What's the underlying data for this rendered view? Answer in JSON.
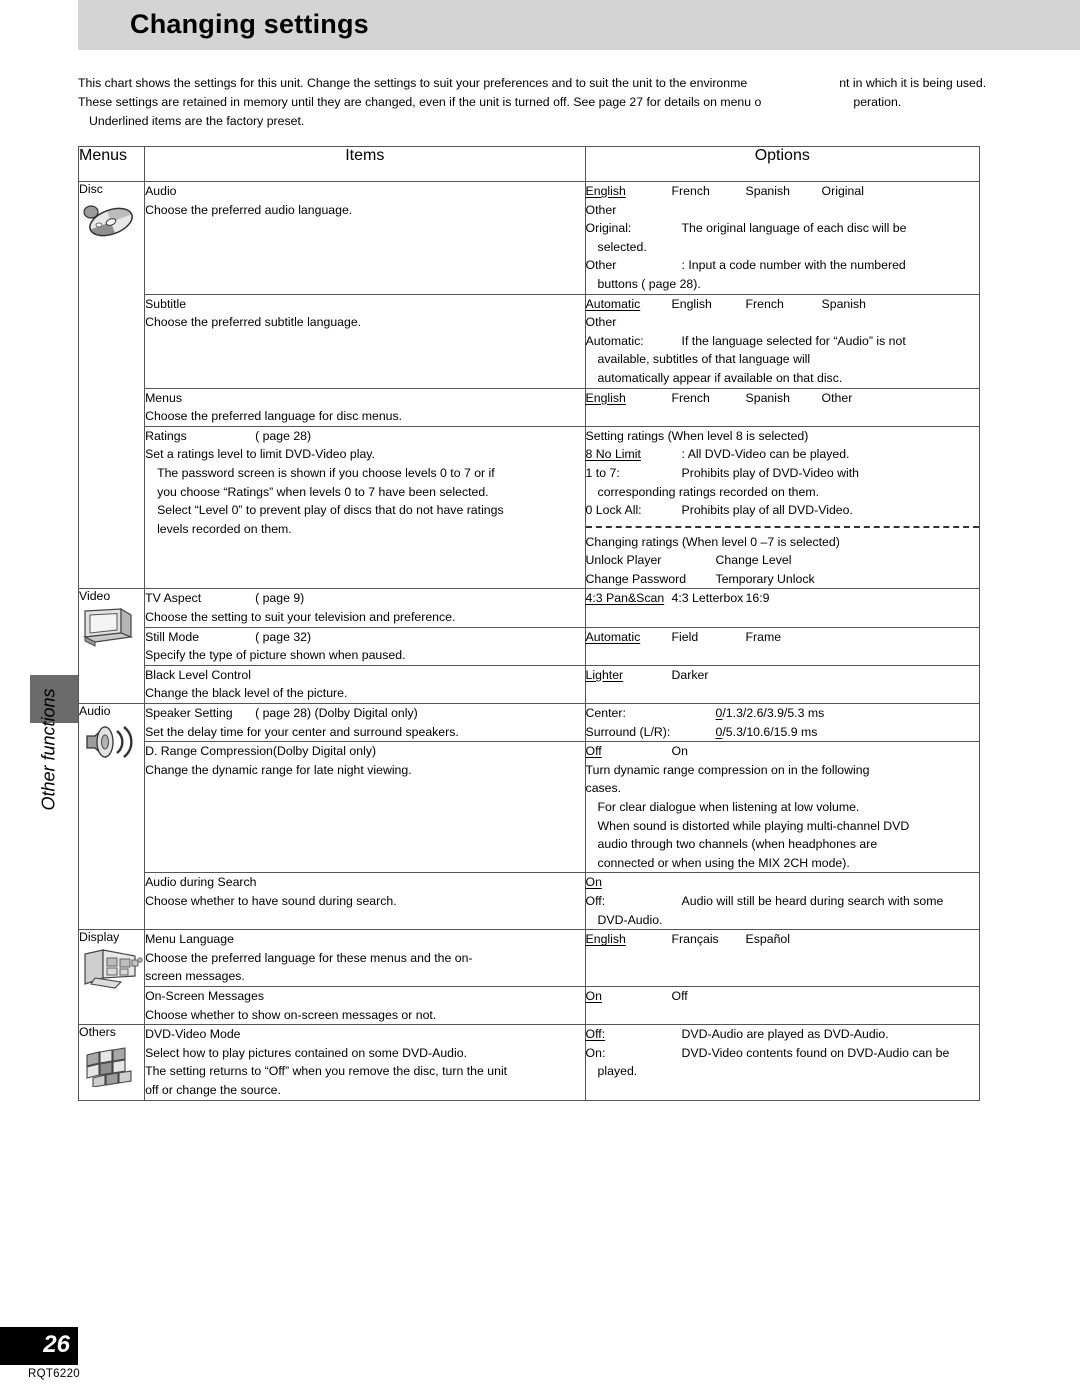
{
  "header": {
    "title": "Changing settings"
  },
  "intro": {
    "line1a": "This chart shows the settings for this unit. Change the settings to suit your preferences and to suit the unit to the environme",
    "line1b": "nt in which it is being used.",
    "line2a": "These settings are retained in memory until they are changed, even if the unit is turned off. See page 27 for details on menu o",
    "line2b": "peration.",
    "line3": "Underlined items are the factory preset."
  },
  "side_tab": {
    "label": "Other functions"
  },
  "footer": {
    "page_number": "26",
    "model_code": "RQT6220"
  },
  "table": {
    "headers": {
      "menus": "Menus",
      "items": "Items",
      "options": "Options"
    },
    "sections": [
      {
        "menu_label": "Disc",
        "menu_icon": "disc-icon",
        "rows": [
          {
            "title": "Audio",
            "desc": "Choose the preferred audio language.",
            "options": {
              "choices": [
                "English",
                "French",
                "Spanish",
                "Original",
                "Other"
              ],
              "preset": "English",
              "notes": [
                {
                  "term": "Original:",
                  "text": "The original language of each disc will be"
                },
                {
                  "cont": "selected."
                },
                {
                  "term": "Other",
                  "text": ":  Input a code number with the numbered"
                },
                {
                  "cont": "buttons (    page 28)."
                }
              ]
            }
          },
          {
            "title": "Subtitle",
            "desc": "Choose the preferred subtitle language.",
            "options": {
              "choices": [
                "Automatic",
                "English",
                "French",
                "Spanish",
                "Other"
              ],
              "preset": "Automatic",
              "notes": [
                {
                  "term": "Automatic:",
                  "text": "If the language selected for “Audio” is not"
                },
                {
                  "cont": "available, subtitles of that language will"
                },
                {
                  "cont": "automatically appear if available on that disc."
                }
              ]
            }
          },
          {
            "title": "Menus",
            "desc": "Choose the preferred language for disc menus.",
            "options": {
              "choices": [
                "English",
                "French",
                "Spanish",
                "Other"
              ],
              "preset": "English",
              "notes": []
            }
          },
          {
            "title": "Ratings",
            "title_ref": "(    page 28)",
            "desc": "Set a ratings level to limit DVD-Video play.",
            "desc_lines": [
              "The password screen is shown if you choose levels 0 to 7 or if",
              "you choose “Ratings” when levels 0 to 7 have been selected.",
              "Select “Level 0” to prevent play of discs that do not have ratings",
              "levels recorded on them."
            ],
            "options": {
              "block1_heading": "Setting ratings (When level 8 is selected)",
              "block1_lines": [
                {
                  "term": "8 No Limit ",
                  "preset": true,
                  "text": ": All DVD-Video can be played."
                },
                {
                  "term": "1 to 7:",
                  "text": "Prohibits play of DVD-Video with"
                },
                {
                  "cont": "corresponding ratings recorded on them."
                },
                {
                  "term": "0 Lock All:",
                  "text": "Prohibits play of all DVD-Video."
                }
              ],
              "block2_heading": "Changing ratings (When level 0    –7 is selected)",
              "block2_lines": [
                [
                  "Unlock Player",
                  "Change Level"
                ],
                [
                  "Change Password",
                  "Temporary Unlock"
                ]
              ]
            }
          }
        ]
      },
      {
        "menu_label": "Video",
        "menu_icon": "tv-icon",
        "rows": [
          {
            "title": "TV Aspect",
            "title_ref": "(    page 9)",
            "desc": "Choose the setting to suit your television and preference.",
            "options": {
              "choices": [
                "4:3 Pan&Scan",
                "4:3 Letterbox",
                "16:9"
              ],
              "preset": "4:3 Pan&Scan",
              "notes": []
            }
          },
          {
            "title": "Still Mode",
            "title_ref": "(    page 32)",
            "desc": "Specify the type of picture shown when paused.",
            "options": {
              "choices": [
                "Automatic",
                "Field",
                "Frame"
              ],
              "preset": "Automatic",
              "notes": []
            }
          },
          {
            "title": "Black Level Control",
            "desc": "Change the black level of the picture.",
            "options": {
              "choices": [
                "Lighter",
                "Darker"
              ],
              "preset": "Lighter",
              "notes": []
            }
          }
        ]
      },
      {
        "menu_label": "Audio",
        "menu_icon": "speaker-icon",
        "rows": [
          {
            "title": "Speaker Setting",
            "title_ref": "(    page 28) (Dolby Digital only)",
            "desc": "Set the delay time for your center and surround speakers.",
            "options": {
              "pairs": [
                {
                  "label": "Center:",
                  "preset": "0",
                  "rest": "/1.3/2.6/3.9/5.3 ms"
                },
                {
                  "label": "Surround (L/R):",
                  "preset": "0",
                  "rest": "/5.3/10.6/15.9 ms"
                }
              ]
            }
          },
          {
            "title": "D. Range Compression",
            "title_ref": "(Dolby Digital only)",
            "desc": "Change the dynamic range for late night viewing.",
            "options": {
              "choices": [
                "Off",
                "On"
              ],
              "preset": "Off",
              "notes": [
                {
                  "cont0": "Turn dynamic range compression on in the following"
                },
                {
                  "cont0": "cases."
                },
                {
                  "cont": "For clear dialogue when listening at low volume."
                },
                {
                  "cont": "When sound is distorted while playing multi-channel DVD"
                },
                {
                  "cont": "audio through two channels (when headphones are"
                },
                {
                  "cont": "connected or when using the MIX 2CH mode)."
                }
              ]
            }
          },
          {
            "title": "Audio during Search",
            "desc": "Choose whether to have sound during search.",
            "options": {
              "choices": [
                "On"
              ],
              "preset": "On",
              "notes": [
                {
                  "term": "Off:",
                  "text": "Audio will still be heard during search with some"
                },
                {
                  "cont": "DVD-Audio."
                }
              ]
            }
          }
        ]
      },
      {
        "menu_label": "Display",
        "menu_icon": "display-icon",
        "rows": [
          {
            "title": "Menu Language",
            "desc": "Choose the preferred language for these menus and the on-",
            "desc_lines": [
              "screen messages."
            ],
            "desc_flush": true,
            "options": {
              "choices": [
                "English",
                "Français",
                "Español"
              ],
              "preset": "English",
              "notes": []
            }
          },
          {
            "title": "On-Screen Messages",
            "desc": "Choose whether to show on-screen messages or not.",
            "options": {
              "choices": [
                "On",
                "Off"
              ],
              "preset": "On",
              "notes": []
            }
          }
        ]
      },
      {
        "menu_label": "Others",
        "menu_icon": "tiles-icon",
        "rows": [
          {
            "title": "DVD-Video Mode",
            "desc": "Select how to play pictures contained on some DVD-Audio.",
            "desc_lines": [
              "The setting returns to “Off” when you remove the disc, turn the unit",
              "off or change the source."
            ],
            "desc_flush": true,
            "options": {
              "notes": [
                {
                  "term": "Off:",
                  "preset": "Off",
                  "text": "DVD-Audio are played as DVD-Audio."
                },
                {
                  "term": "On:",
                  "text": "DVD-Video contents found on DVD-Audio can be"
                },
                {
                  "cont": "played."
                }
              ]
            }
          }
        ]
      }
    ]
  }
}
